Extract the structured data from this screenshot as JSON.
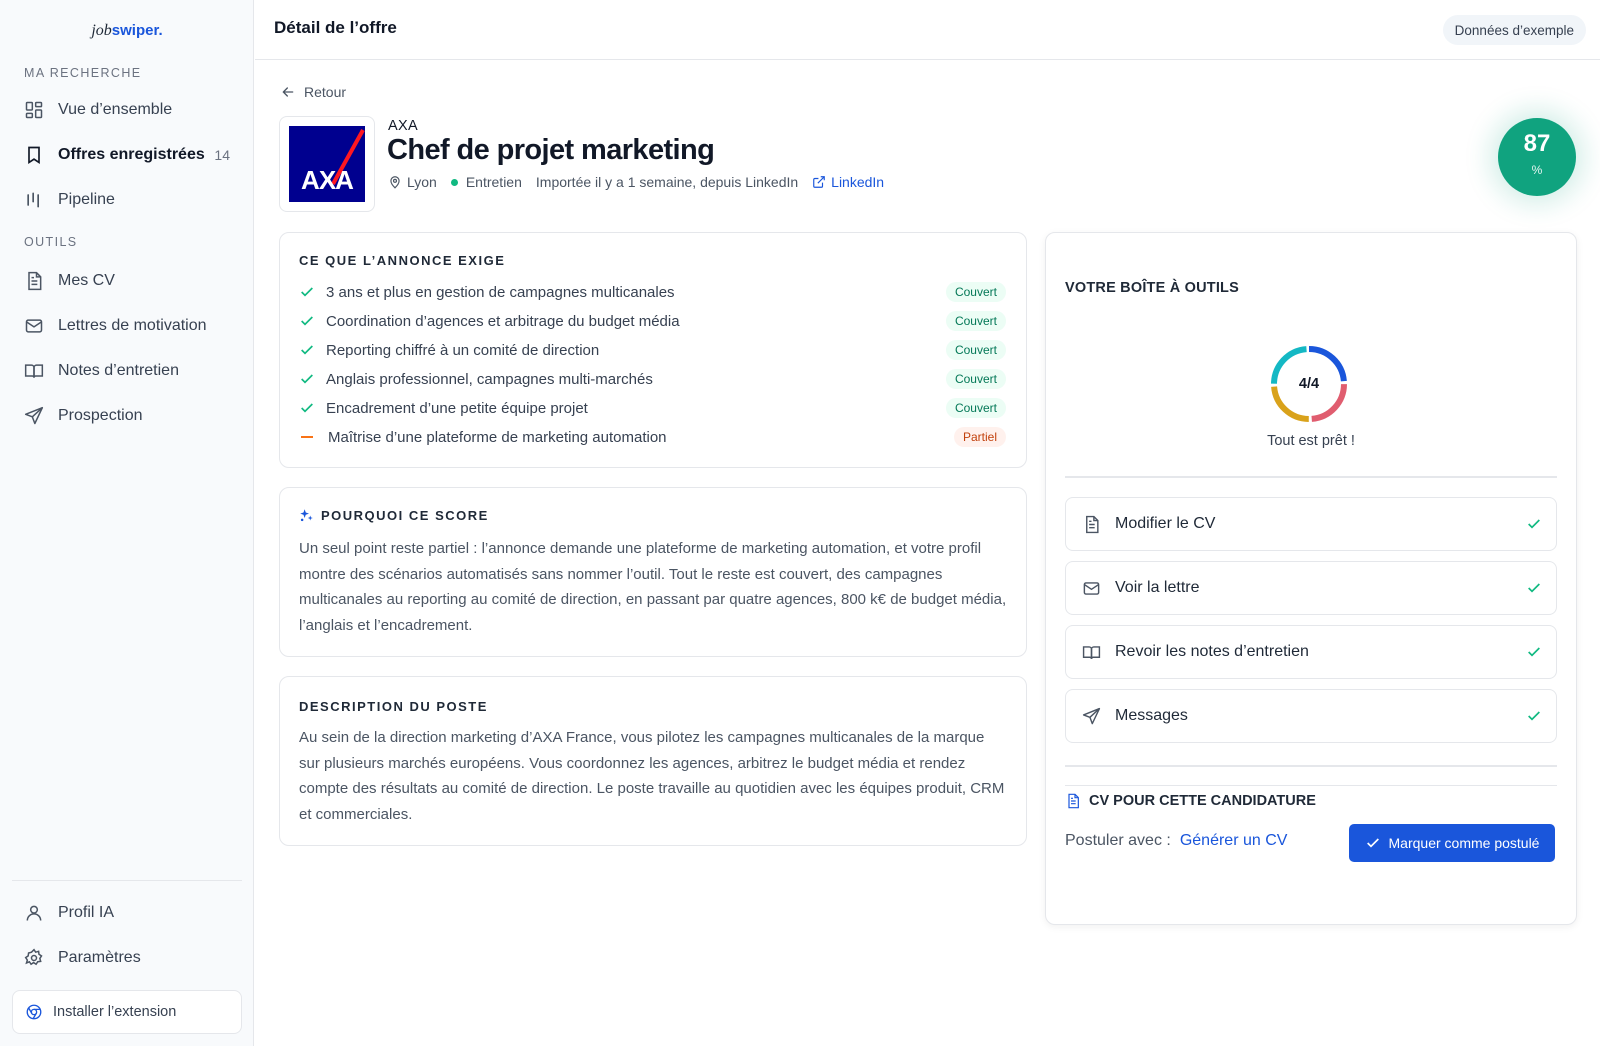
{
  "logo": {
    "part1": "job",
    "part2": "swiper."
  },
  "sidebar": {
    "section_search": "MA RECHERCHE",
    "items_search": [
      {
        "label": "Vue d’ensemble",
        "icon": "grid-icon"
      },
      {
        "label": "Offres enregistrées",
        "icon": "bookmark-icon",
        "count": "14",
        "active": true
      },
      {
        "label": "Pipeline",
        "icon": "pipeline-icon"
      }
    ],
    "section_tools": "OUTILS",
    "items_tools": [
      {
        "label": "Mes CV",
        "icon": "document-icon"
      },
      {
        "label": "Lettres de motivation",
        "icon": "mail-icon"
      },
      {
        "label": "Notes d’entretien",
        "icon": "book-icon"
      },
      {
        "label": "Prospection",
        "icon": "send-icon"
      }
    ],
    "items_bottom": [
      {
        "label": "Profil IA",
        "icon": "user-icon"
      },
      {
        "label": "Paramètres",
        "icon": "gear-icon"
      }
    ],
    "extension_button": "Installer l’extension"
  },
  "header": {
    "title": "Détail de l’offre",
    "badge": "Données d’exemple"
  },
  "offer": {
    "back_label": "Retour",
    "company": "AXA",
    "logo_text": "AXA",
    "title": "Chef de projet marketing",
    "location": "Lyon",
    "status": "Entretien",
    "imported": "Importée il y a 1 semaine, depuis LinkedIn",
    "source_link": "LinkedIn",
    "score": "87",
    "score_unit": "%"
  },
  "requirements": {
    "label": "CE QUE L’ANNONCE EXIGE",
    "items": [
      {
        "text": "3 ans et plus en gestion de campagnes multicanales",
        "badge": "Couvert",
        "status": "covered"
      },
      {
        "text": "Coordination d’agences et arbitrage du budget média",
        "badge": "Couvert",
        "status": "covered"
      },
      {
        "text": "Reporting chiffré à un comité de direction",
        "badge": "Couvert",
        "status": "covered"
      },
      {
        "text": "Anglais professionnel, campagnes multi-marchés",
        "badge": "Couvert",
        "status": "covered"
      },
      {
        "text": "Encadrement d’une petite équipe projet",
        "badge": "Couvert",
        "status": "covered"
      },
      {
        "text": "Maîtrise d’une plateforme de marketing automation",
        "badge": "Partiel",
        "status": "partial"
      }
    ]
  },
  "why_score": {
    "label": "POURQUOI CE SCORE",
    "text": "Un seul point reste partiel : l’annonce demande une plateforme de marketing automation, et votre profil montre des scénarios automatisés sans nommer l’outil. Tout le reste est couvert, des campagnes multicanales au reporting au comité de direction, en passant par quatre agences, 800 k€ de budget média, l’anglais et l’encadrement."
  },
  "description": {
    "label": "DESCRIPTION DU POSTE",
    "text": "Au sein de la direction marketing d’AXA France, vous pilotez les campagnes multicanales de la marque sur plusieurs marchés européens. Vous coordonnez les agences, arbitrez le budget média et rendez compte des résultats au comité de direction. Le poste travaille au quotidien avec les équipes produit, CRM et commerciales."
  },
  "toolbox": {
    "title": "VOTRE BOÎTE À OUTILS",
    "progress": "4/4",
    "progress_value": 1.0,
    "ready_text": "Tout est prêt !",
    "items": [
      {
        "label": "Modifier le CV",
        "icon": "document-icon",
        "done": true
      },
      {
        "label": "Voir la lettre",
        "icon": "mail-icon",
        "done": true
      },
      {
        "label": "Revoir les notes d’entretien",
        "icon": "book-icon",
        "done": true
      },
      {
        "label": "Messages",
        "icon": "send-icon",
        "done": true
      }
    ],
    "cv_title": "CV POUR CETTE CANDIDATURE",
    "apply_with": "Postuler avec :",
    "generate_link": "Générer un CV",
    "mark_button": "Marquer comme postulé"
  },
  "colors": {
    "accent": "#1a56db",
    "success": "#10b981",
    "score_bg": "#10a37f",
    "axa_blue": "#00008f",
    "axa_red": "#ff1721",
    "partial": "#f97316"
  }
}
